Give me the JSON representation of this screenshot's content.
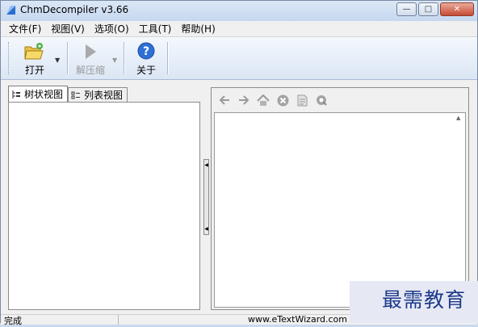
{
  "window": {
    "title": "ChmDecompiler v3.66",
    "controls": {
      "minimize": "—",
      "maximize": "□",
      "close": "✕"
    }
  },
  "menu": {
    "items": [
      "文件(F)",
      "视图(V)",
      "选项(O)",
      "工具(T)",
      "帮助(H)"
    ]
  },
  "toolbar": {
    "open_label": "打开",
    "decompress_label": "解压缩",
    "about_label": "关于",
    "icons": {
      "open": "folder-open-icon",
      "decompress": "play-arrow-icon",
      "about": "help-icon"
    }
  },
  "left_pane": {
    "tabs": [
      "树状视图",
      "列表视图"
    ]
  },
  "right_pane": {
    "nav_icons": [
      "back-arrow-icon",
      "forward-arrow-icon",
      "home-icon",
      "stop-icon",
      "page-icon",
      "zoom-icon"
    ]
  },
  "status": {
    "left_text": "完成",
    "right_text": "www.eTextWizard.com"
  },
  "watermark": {
    "text": "最需教育"
  },
  "colors": {
    "accent_blue": "#1d3a8a",
    "toolbar_top": "#f4f8fd",
    "toolbar_bottom": "#dbe6f4",
    "close_red": "#c74b34"
  }
}
